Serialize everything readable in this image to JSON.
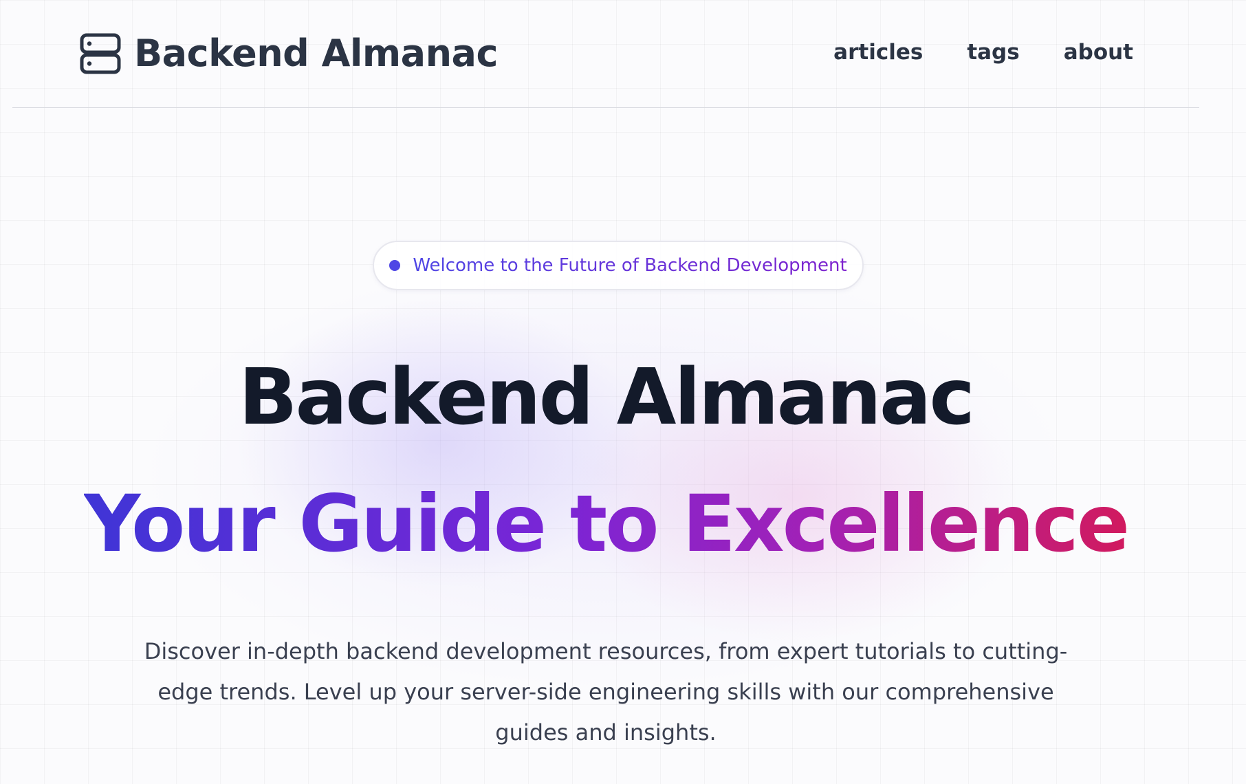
{
  "header": {
    "brand": {
      "icon": "server-icon",
      "label": "Backend Almanac"
    },
    "nav": [
      {
        "label": "articles"
      },
      {
        "label": "tags"
      },
      {
        "label": "about"
      }
    ]
  },
  "hero": {
    "badge": {
      "text": "Welcome to the Future of Backend Development",
      "dot_color": "#4f46e5"
    },
    "title": "Backend Almanac",
    "subtitle": "Your Guide to Excellence",
    "subtitle_gradient": [
      "#3f35d6",
      "#7a25d6",
      "#a221b6",
      "#d11a5e"
    ],
    "description": "Discover in-depth backend development resources, from expert tutorials to cutting-edge trends. Level up your server-side engineering skills with our comprehensive guides and insights."
  }
}
